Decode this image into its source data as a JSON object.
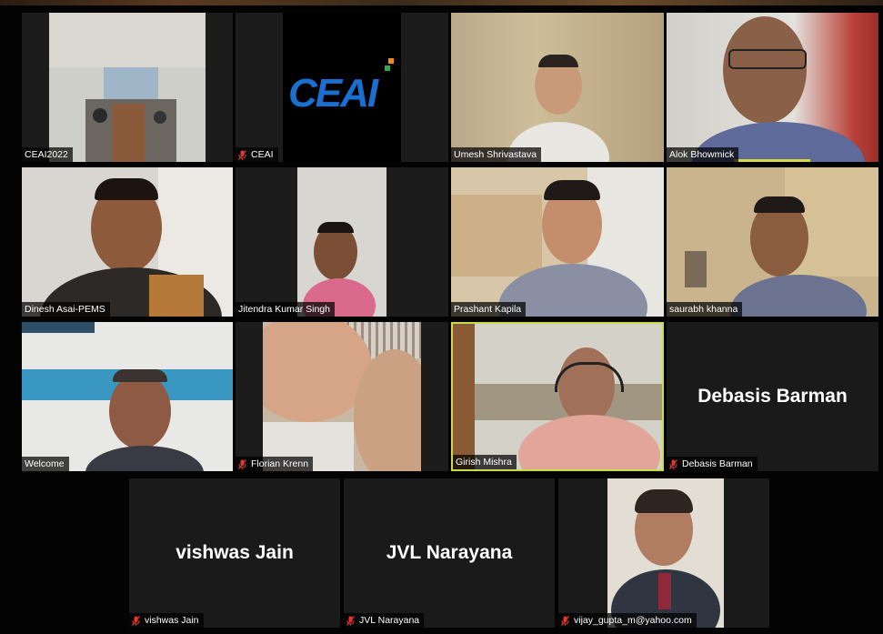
{
  "meeting": {
    "participants": [
      {
        "name": "CEAI2022",
        "muted": false
      },
      {
        "name": "CEAI",
        "muted": true,
        "logo_text": "CEAI"
      },
      {
        "name": "Umesh Shrivastava",
        "muted": false
      },
      {
        "name": "Alok Bhowmick",
        "muted": false,
        "speaking": true
      },
      {
        "name": "Dinesh Asai-PEMS",
        "muted": false
      },
      {
        "name": "Jitendra Kumar Singh",
        "muted": false
      },
      {
        "name": "Prashant Kapila",
        "muted": false
      },
      {
        "name": "saurabh khanna",
        "muted": false
      },
      {
        "name": "Welcome",
        "muted": false
      },
      {
        "name": "Florian Krenn",
        "muted": true
      },
      {
        "name": "Girish Mishra",
        "muted": false,
        "active": true
      },
      {
        "name": "Debasis Barman",
        "muted": true,
        "video": false,
        "display_name": "Debasis Barman"
      },
      {
        "name": "vishwas Jain",
        "muted": true,
        "video": false,
        "display_name": "vishwas Jain"
      },
      {
        "name": "JVL Narayana",
        "muted": true,
        "video": false,
        "display_name": "JVL Narayana"
      },
      {
        "name": "vijay_gupta_m@yahoo.com",
        "muted": true
      }
    ]
  },
  "colors": {
    "active_border": "#c9dd4a",
    "muted_icon": "#e0392f",
    "logo_blue": "#1a6fd0",
    "logo_orange": "#f08a1c",
    "logo_green": "#3aa84a"
  }
}
